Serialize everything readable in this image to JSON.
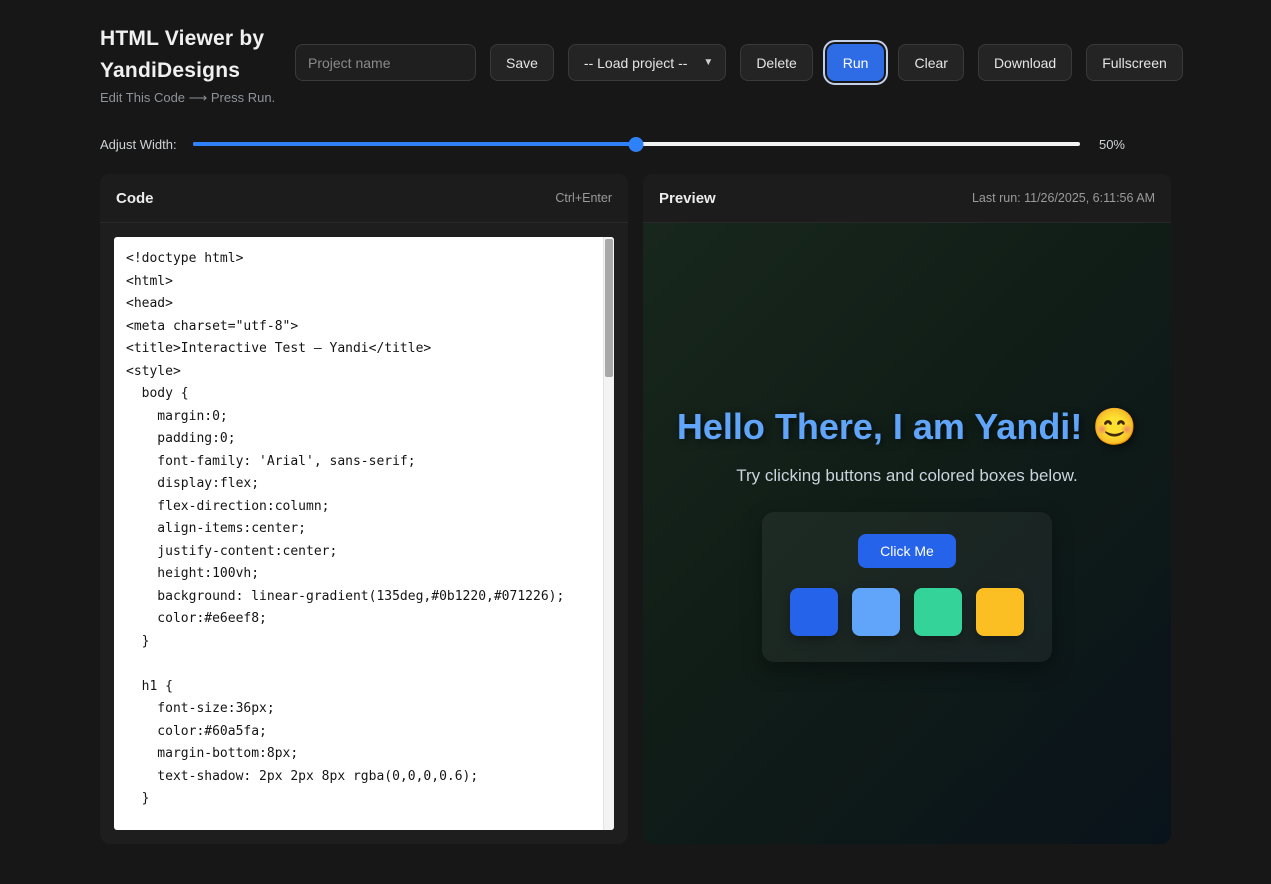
{
  "header": {
    "title": "HTML Viewer by YandiDesigns",
    "subtitle": "Edit This Code ⟶ Press Run."
  },
  "toolbar": {
    "project_name_placeholder": "Project name",
    "save_label": "Save",
    "load_project_label": "-- Load project --",
    "delete_label": "Delete",
    "run_label": "Run",
    "clear_label": "Clear",
    "download_label": "Download",
    "fullscreen_label": "Fullscreen"
  },
  "width_control": {
    "label": "Adjust Width:",
    "value_percent": 50,
    "value_label": "50%"
  },
  "code_panel": {
    "title": "Code",
    "shortcut": "Ctrl+Enter",
    "code": "<!doctype html>\n<html>\n<head>\n<meta charset=\"utf-8\">\n<title>Interactive Test — Yandi</title>\n<style>\n  body {\n    margin:0;\n    padding:0;\n    font-family: 'Arial', sans-serif;\n    display:flex;\n    flex-direction:column;\n    align-items:center;\n    justify-content:center;\n    height:100vh;\n    background: linear-gradient(135deg,#0b1220,#071226);\n    color:#e6eef8;\n  }\n\n  h1 {\n    font-size:36px;\n    color:#60a5fa;\n    margin-bottom:8px;\n    text-shadow: 2px 2px 8px rgba(0,0,0,0.6);\n  }"
  },
  "preview_panel": {
    "title": "Preview",
    "last_run": "Last run: 11/26/2025, 6:11:56 AM",
    "heading": "Hello There, I am Yandi! 😊",
    "subheading": "Try clicking buttons and colored boxes below.",
    "button_label": "Click Me",
    "box_colors": [
      "#2563eb",
      "#60a5fa",
      "#34d399",
      "#fbbf24"
    ]
  },
  "colors": {
    "accent": "#2f81f7",
    "run_button": "#2e6ce6",
    "preview_heading": "#60a5fa",
    "preview_button": "#2563eb"
  }
}
